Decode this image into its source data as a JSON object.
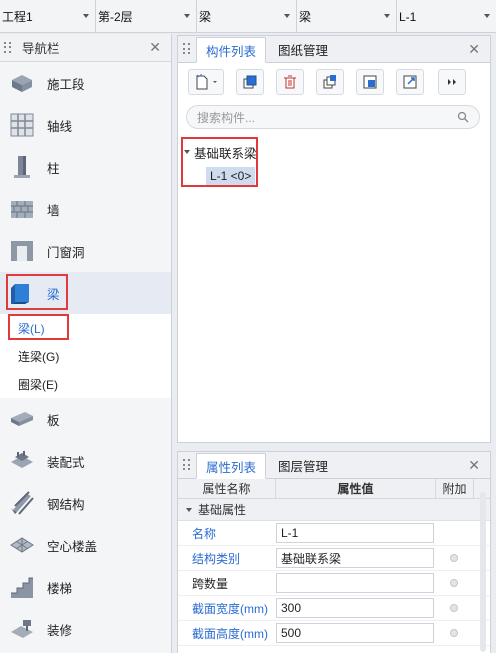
{
  "selectors": [
    {
      "value": "工程1"
    },
    {
      "value": "第-2层"
    },
    {
      "value": "梁"
    },
    {
      "value": "梁"
    },
    {
      "value": "L-1"
    }
  ],
  "nav": {
    "title": "导航栏",
    "items": [
      {
        "label": "施工段",
        "icon": "construction-section-icon"
      },
      {
        "label": "轴线",
        "icon": "grid-axis-icon"
      },
      {
        "label": "柱",
        "icon": "column-icon"
      },
      {
        "label": "墙",
        "icon": "wall-icon"
      },
      {
        "label": "门窗洞",
        "icon": "door-window-icon"
      },
      {
        "label": "梁",
        "icon": "beam-icon"
      }
    ],
    "beam_subitems": [
      "梁(L)",
      "连梁(G)",
      "圈梁(E)"
    ],
    "items_after": [
      {
        "label": "板",
        "icon": "slab-icon"
      },
      {
        "label": "装配式",
        "icon": "prefab-icon"
      },
      {
        "label": "钢结构",
        "icon": "steel-structure-icon"
      },
      {
        "label": "空心楼盖",
        "icon": "hollow-floor-icon"
      },
      {
        "label": "楼梯",
        "icon": "stair-icon"
      },
      {
        "label": "装修",
        "icon": "decoration-icon"
      }
    ]
  },
  "component_panel": {
    "tabs": [
      "构件列表",
      "图纸管理"
    ],
    "search_placeholder": "搜索构件...",
    "tree_group": "基础联系梁",
    "tree_leaf": "L-1 <0>"
  },
  "property_panel": {
    "tabs": [
      "属性列表",
      "图层管理"
    ],
    "columns": [
      "属性名称",
      "属性值",
      "附加"
    ],
    "group": "基础属性",
    "rows": [
      {
        "name": "名称",
        "value": "L-1",
        "blue": true,
        "extra": false
      },
      {
        "name": "结构类别",
        "value": "基础联系梁",
        "blue": true,
        "extra": true
      },
      {
        "name": "跨数量",
        "value": "",
        "blue": false,
        "extra": true
      },
      {
        "name": "截面宽度(mm)",
        "value": "300",
        "blue": true,
        "extra": true
      },
      {
        "name": "截面高度(mm)",
        "value": "500",
        "blue": true,
        "extra": true
      }
    ]
  },
  "colors": {
    "accent": "#2b6cd0",
    "highlight": "#e03a3a"
  }
}
